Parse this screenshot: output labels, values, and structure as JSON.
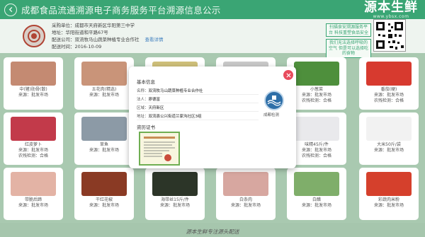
{
  "header": {
    "title": "成都食品流通溯源电子商务服务平台溯源信息公示",
    "brand": "源本生鲜",
    "brand_url": "www.ybsx.com"
  },
  "market_info": {
    "unit_label": "采购单位：",
    "unit": "成都市天府新区华阳第三中学",
    "address_label": "地址：",
    "address": "华阳街道和平路67号",
    "supplier_label": "配送公司：",
    "supplier": "双流牧马山蔬菜种植专业合作社",
    "detail_link": "查看详情",
    "date_label": "配送时间：",
    "date": "2016-10-09"
  },
  "notices": [
    "扫描食安溯源服务平台 科技重塑食品安全",
    "我们无法选择呼吸的空气 但是可以选择吃的食物"
  ],
  "products": [
    {
      "name": "中(猪)肋骨(散)",
      "source": "来源：批发市场",
      "extra": "",
      "color": "#c48a72"
    },
    {
      "name": "五花肉(精选)",
      "source": "来源：批发市场",
      "extra": "",
      "color": "#c99479"
    },
    {
      "name": "",
      "source": "",
      "extra": "",
      "color": "#cfc07a"
    },
    {
      "name": "",
      "source": "",
      "extra": "",
      "color": "#c9c9c9"
    },
    {
      "name": "小葱菜",
      "source": "来源：批发市场",
      "extra": "农残检测：合格",
      "color": "#4e8f3c"
    },
    {
      "name": "番茄(硬)",
      "source": "来源：批发市场",
      "extra": "农残检测：合格",
      "color": "#d73a2f"
    },
    {
      "name": "红皮萝卜",
      "source": "来源：批发市场",
      "extra": "农残检测：合格",
      "color": "#c23a4a"
    },
    {
      "name": "草鱼",
      "source": "来源：批发市场",
      "extra": "",
      "color": "#8c9aa6"
    },
    {
      "name": "",
      "source": "",
      "extra": "",
      "color": "#d8d8d8"
    },
    {
      "name": "",
      "source": "",
      "extra": "",
      "color": "#d8d8d8"
    },
    {
      "name": "味精45斤/件",
      "source": "来源：批发市场",
      "extra": "农残检测：合格",
      "color": "#e9e9ec"
    },
    {
      "name": "大米50斤/袋",
      "source": "来源：批发市场",
      "extra": "",
      "color": "#f2f2f2"
    },
    {
      "name": "带脆后蹄",
      "source": "来源：批发市场",
      "extra": "",
      "color": "#e3b3a5"
    },
    {
      "name": "干红花椒",
      "source": "来源：批发市场",
      "extra": "",
      "color": "#8a3a24"
    },
    {
      "name": "海带丝15斤/件",
      "source": "来源：批发市场",
      "extra": "",
      "color": "#2c3528"
    },
    {
      "name": "白条肉",
      "source": "来源：批发市场",
      "extra": "",
      "color": "#d7a7a0"
    },
    {
      "name": "白醋",
      "source": "来源：批发市场",
      "extra": "",
      "color": "#7fae6a"
    },
    {
      "name": "彩蔬肉米粉",
      "source": "来源：批发市场",
      "extra": "",
      "color": "#d5402c"
    }
  ],
  "modal": {
    "section_basic": "基本信息",
    "name_label": "名称：",
    "name_value": "双流牧马山蔬菜种植专业合作社",
    "legal_label": "法人：",
    "legal_value": "廖德富",
    "region_label": "区域：",
    "region_value": "天府新区",
    "address_label": "地址：",
    "address_value": "双流县公兴街道兰家沟社区3组",
    "authority": "成都检测",
    "section_cert": "资历证书"
  },
  "footer": {
    "slogan": "源本生鲜专注源头配送"
  },
  "colors": {
    "accent": "#3aa574",
    "close": "#e84b5d",
    "background": "#a9c9b0"
  }
}
